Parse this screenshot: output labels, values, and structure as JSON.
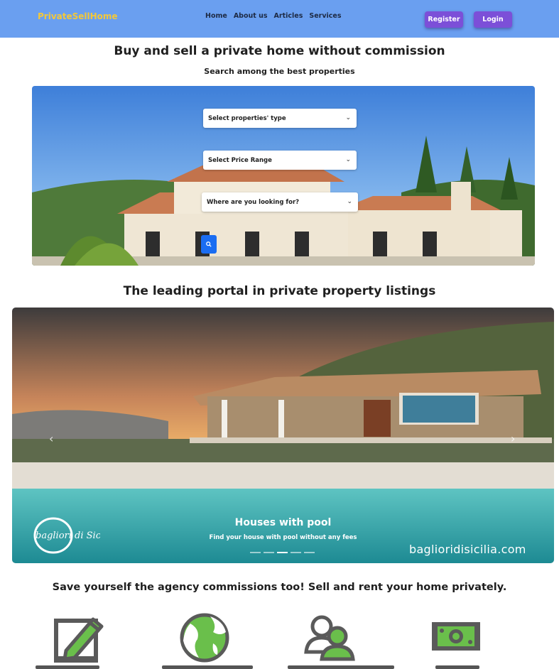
{
  "navbar": {
    "brand": "PrivateSellHome",
    "links": [
      "Home",
      "About us",
      "Articles",
      "Services"
    ],
    "register_label": "Register",
    "login_label": "Login"
  },
  "hero": {
    "title": "Buy and sell a private home without commission",
    "subtitle": "Search among the best properties",
    "type_select": "Select properties' type",
    "price_select": "Select Price Range",
    "location_select": "Where are you looking for?"
  },
  "portal": {
    "title": "The leading portal in private property listings"
  },
  "carousel": {
    "caption_title": "Houses with pool",
    "caption_text": "Find your house with pool without any fees",
    "watermark": "baglioridisicilia.com",
    "logo_text": "bagliori di Sicilia",
    "slides_count": 5,
    "active_slide": 3
  },
  "features": {
    "title": "Save yourself the agency commissions too! Sell and rent your home privately.",
    "icons": [
      "edit-pencil-icon",
      "globe-icon",
      "users-icon",
      "money-icon"
    ]
  },
  "colors": {
    "navbar": "#6a9ff0",
    "brand": "#f3c83a",
    "button": "#7c4fd8",
    "search": "#1a6df2",
    "icon_green": "#6abf4b",
    "icon_gray": "#5a5a5a"
  }
}
